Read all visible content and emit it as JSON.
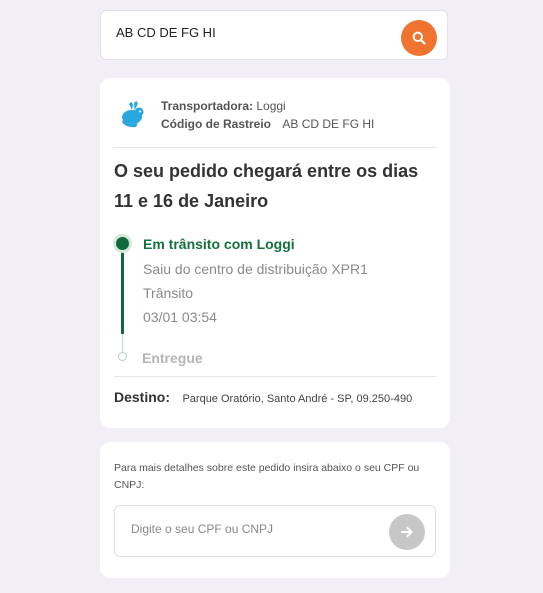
{
  "search": {
    "value": "AB CD DE FG HI",
    "button_icon": "search-icon",
    "button_color": "#f07330"
  },
  "tracking": {
    "carrier_label": "Transportadora:",
    "carrier_value": "Loggi",
    "code_label": "Código de Rastreio",
    "code_value": "AB CD DE FG HI",
    "carrier_icon": "loggi-rabbit-logo",
    "headline": "O seu pedido chegará entre os dias 11 e 16 de Janeiro",
    "timeline": {
      "current": {
        "title": "Em trânsito com Loggi",
        "description": "Saiu do centro de distribuição XPR1",
        "status": "Trânsito",
        "datetime": "03/01 03:54"
      },
      "next": {
        "title": "Entregue"
      }
    },
    "destination_label": "Destino:",
    "destination_value": "Parque Oratório, Santo André - SP, 09.250-490"
  },
  "cpf": {
    "instructions": "Para mais detalhes sobre este pedido insira abaixo o seu CPF ou CNPJ:",
    "placeholder": "Digite o seu CPF ou CNPJ",
    "button_icon": "arrow-right-icon"
  },
  "colors": {
    "accent": "#f07330",
    "success": "#16703d",
    "background": "#f1eef5",
    "logo_blue": "#29a8e0"
  }
}
